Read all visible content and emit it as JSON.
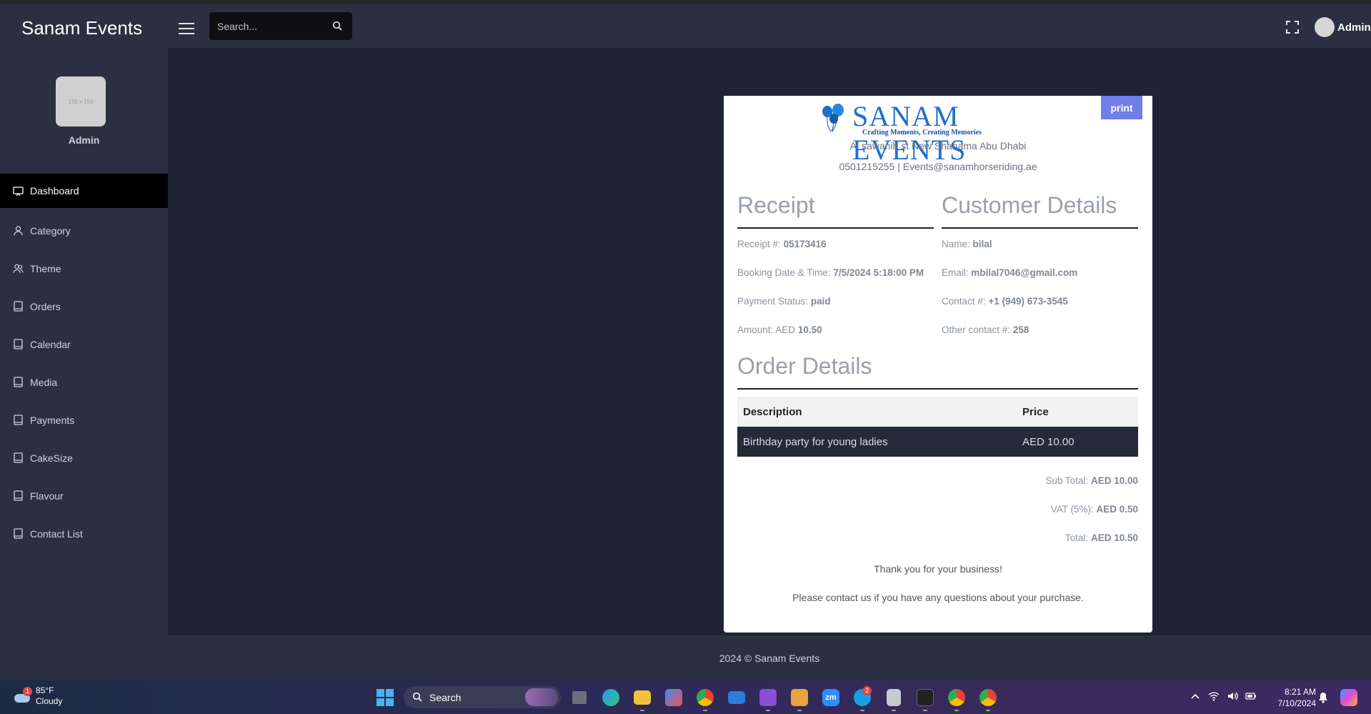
{
  "app": {
    "brand": "Sanam Events",
    "search_placeholder": "Search...",
    "admin_label": "Admin"
  },
  "sidebar": {
    "avatar_caption": "150 x 150",
    "profile_name": "Admin",
    "items": [
      {
        "label": "Dashboard",
        "icon": "monitor-icon"
      },
      {
        "label": "Category",
        "icon": "user-icon"
      },
      {
        "label": "Theme",
        "icon": "users-icon"
      },
      {
        "label": "Orders",
        "icon": "book-icon"
      },
      {
        "label": "Calendar",
        "icon": "book-icon"
      },
      {
        "label": "Media",
        "icon": "book-icon"
      },
      {
        "label": "Payments",
        "icon": "book-icon"
      },
      {
        "label": "CakeSize",
        "icon": "book-icon"
      },
      {
        "label": "Flavour",
        "icon": "book-icon"
      },
      {
        "label": "Contact List",
        "icon": "book-icon"
      }
    ]
  },
  "receipt": {
    "print_label": "print",
    "logo_text": "SANAM EVENTS",
    "logo_tagline": "Crafting Moments, Creating Memories",
    "address": "Al sawanih st New Shahama Abu Dhabi",
    "contact": "0501215255 | Events@sanamhorseriding.ae",
    "receipt_title": "Receipt",
    "customer_title": "Customer Details",
    "receipt_no_label": "Receipt #:",
    "receipt_no": "05173416",
    "booking_label": "Booking Date & Time:",
    "booking_value": "7/5/2024 5:18:00 PM",
    "payment_label": "Payment Status:",
    "payment_value": "paid",
    "amount_label": "Amount: AED",
    "amount_value": "10.50",
    "name_label": "Name:",
    "name_value": "bilal",
    "email_label": "Email:",
    "email_value": "mbilal7046@gmail.com",
    "contact_label": "Contact #:",
    "contact_value": "+1 (949) 673-3545",
    "other_contact_label": "Other contact #:",
    "other_contact_value": "258",
    "order_title": "Order Details",
    "table": {
      "headers": [
        "Description",
        "Price"
      ],
      "rows": [
        [
          "Birthday party for young ladies",
          "AED 10.00"
        ]
      ]
    },
    "subtotal_label": "Sub Total:",
    "subtotal_value": "AED 10.00",
    "vat_label": "VAT (5%):",
    "vat_value": "AED 0.50",
    "total_label": "Total:",
    "total_value": "AED 10.50",
    "thanks": "Thank you for your business!",
    "questions": "Please contact us if you have any questions about your purchase."
  },
  "footer": {
    "text": "2024 © Sanam Events"
  },
  "taskbar": {
    "weather_temp": "85°F",
    "weather_desc": "Cloudy",
    "weather_badge": "1",
    "search_label": "Search",
    "time": "8:21 AM",
    "date": "7/10/2024",
    "skype_badge": "2",
    "zoom_label": "zm"
  },
  "colors": {
    "topbar": "#2a3042",
    "content_bg": "#1e2433",
    "active_nav": "#000000",
    "print_button": "#6f7ee8",
    "logo_blue": "#1f6fc9"
  }
}
